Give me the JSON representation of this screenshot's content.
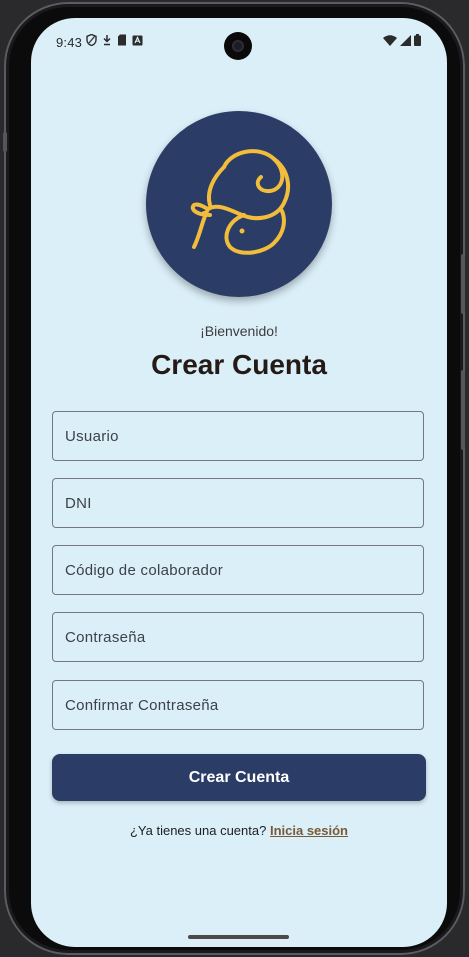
{
  "status_bar": {
    "time": "9:43",
    "left_icons": [
      "shield-icon",
      "download-icon",
      "sd-card-icon",
      "keyboard-icon"
    ],
    "right_icons": [
      "wifi-icon",
      "signal-icon",
      "battery-icon"
    ]
  },
  "header": {
    "logo_icon": "s-mouse-logo-icon",
    "welcome": "¡Bienvenido!",
    "title": "Crear Cuenta"
  },
  "form": {
    "fields": [
      {
        "label": "Usuario"
      },
      {
        "label": "DNI"
      },
      {
        "label": "Código de colaborador"
      },
      {
        "label": "Contraseña"
      },
      {
        "label": "Confirmar Contraseña"
      }
    ],
    "submit_label": "Crear Cuenta"
  },
  "footer": {
    "prompt": "¿Ya tienes una cuenta?",
    "login_link": "Inicia sesión"
  },
  "colors": {
    "background": "#dbeff9",
    "primary": "#2b3d66",
    "logo_accent": "#f2bd3a",
    "link": "#7a5a36"
  }
}
